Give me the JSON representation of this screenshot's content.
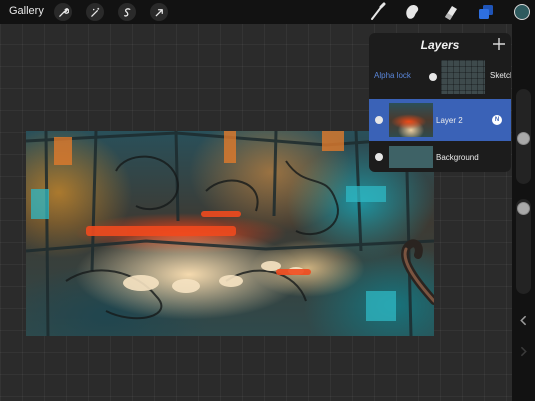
{
  "toolbar": {
    "gallery_label": "Gallery",
    "left_tools": [
      "wrench-icon",
      "magic-wand-icon",
      "selection-icon",
      "transform-arrow-icon"
    ],
    "right_tools": [
      "brush-icon",
      "smudge-icon",
      "eraser-icon",
      "layers-icon"
    ],
    "active_tool": "layers-icon",
    "accent_color": "#2e6fe0",
    "current_color": "#2e5a5e"
  },
  "layers_panel": {
    "title": "Layers",
    "add_icon": "plus-icon",
    "alpha_lock_label": "Alpha lock",
    "items": [
      {
        "name": "Sketch",
        "visible": true,
        "selected": false
      },
      {
        "name": "Layer 2",
        "visible": true,
        "selected": true,
        "blend_badge": "N"
      },
      {
        "name": "Background",
        "visible": true,
        "selected": false
      }
    ],
    "selected_color": "#3a62b7"
  },
  "sidebar": {
    "brush_size_slider": "slider",
    "opacity_slider": "slider",
    "undo_icon": "chevron-left-icon",
    "redo_icon": "chevron-right-icon"
  }
}
